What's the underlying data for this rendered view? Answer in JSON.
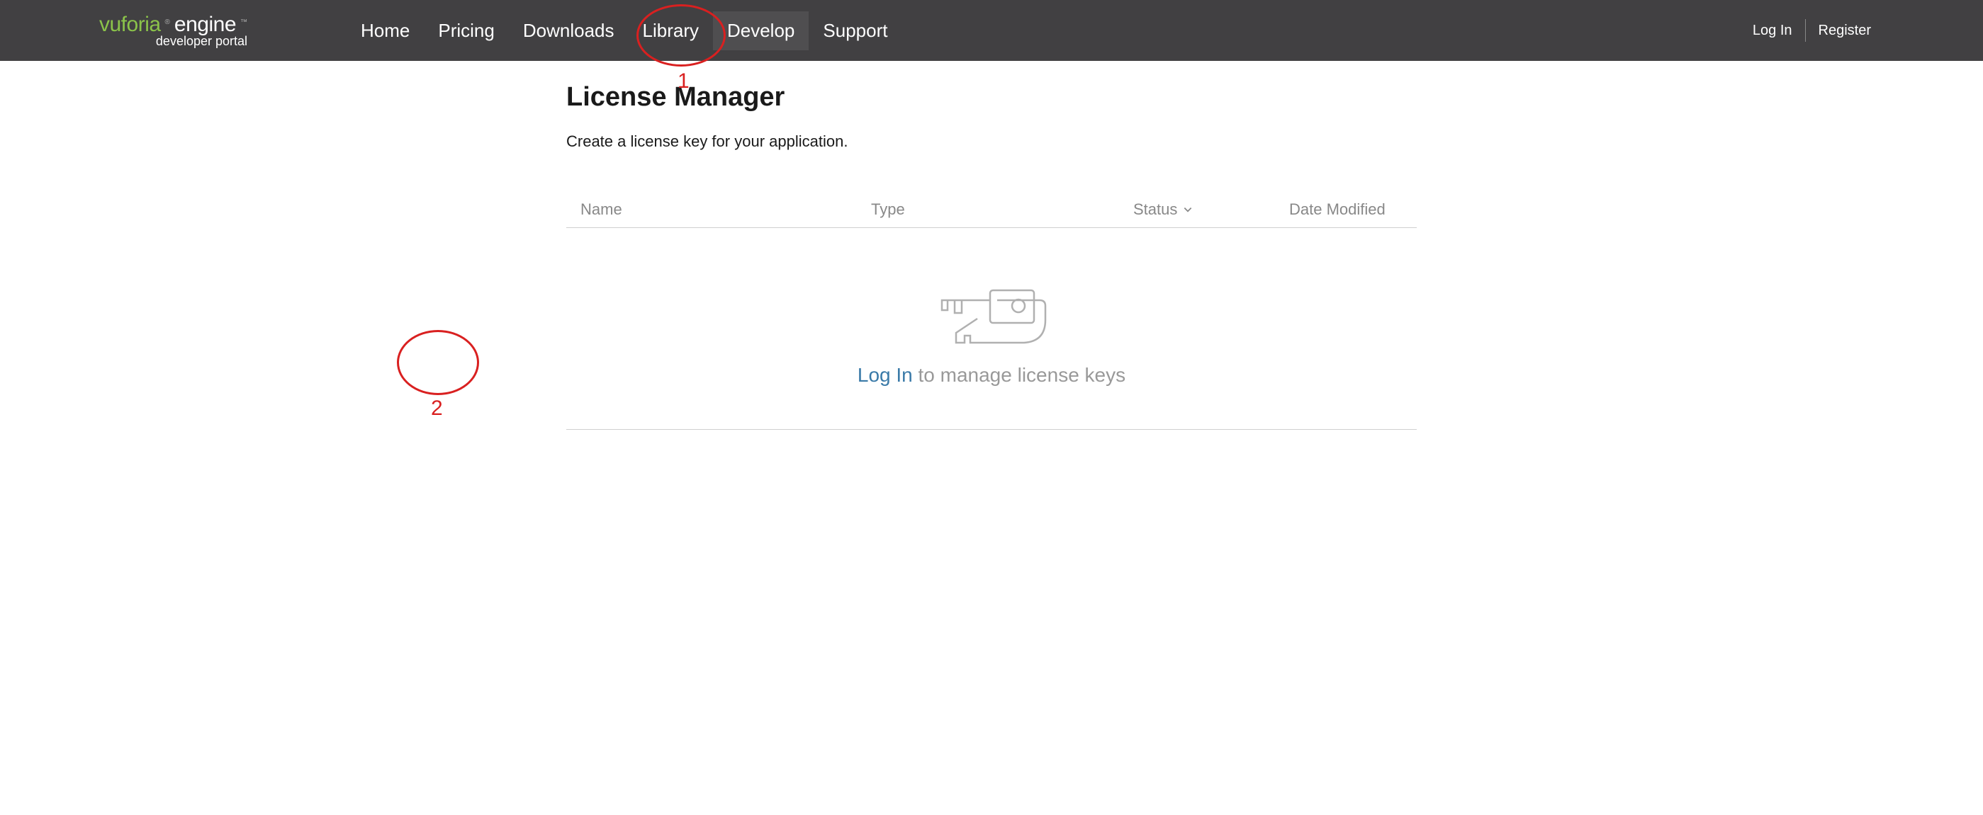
{
  "logo": {
    "brand": "vuforia",
    "suffix": "engine",
    "subtitle": "developer portal"
  },
  "nav": {
    "items": [
      {
        "label": "Home"
      },
      {
        "label": "Pricing"
      },
      {
        "label": "Downloads"
      },
      {
        "label": "Library"
      },
      {
        "label": "Develop",
        "active": true
      },
      {
        "label": "Support"
      }
    ]
  },
  "auth": {
    "login": "Log In",
    "register": "Register"
  },
  "page": {
    "title": "License Manager",
    "subtitle": "Create a license key for your application."
  },
  "table": {
    "headers": {
      "name": "Name",
      "type": "Type",
      "status": "Status",
      "date": "Date Modified"
    }
  },
  "empty": {
    "login_link": "Log In",
    "suffix": " to manage license keys"
  },
  "annotations": {
    "one": "1",
    "two": "2"
  }
}
